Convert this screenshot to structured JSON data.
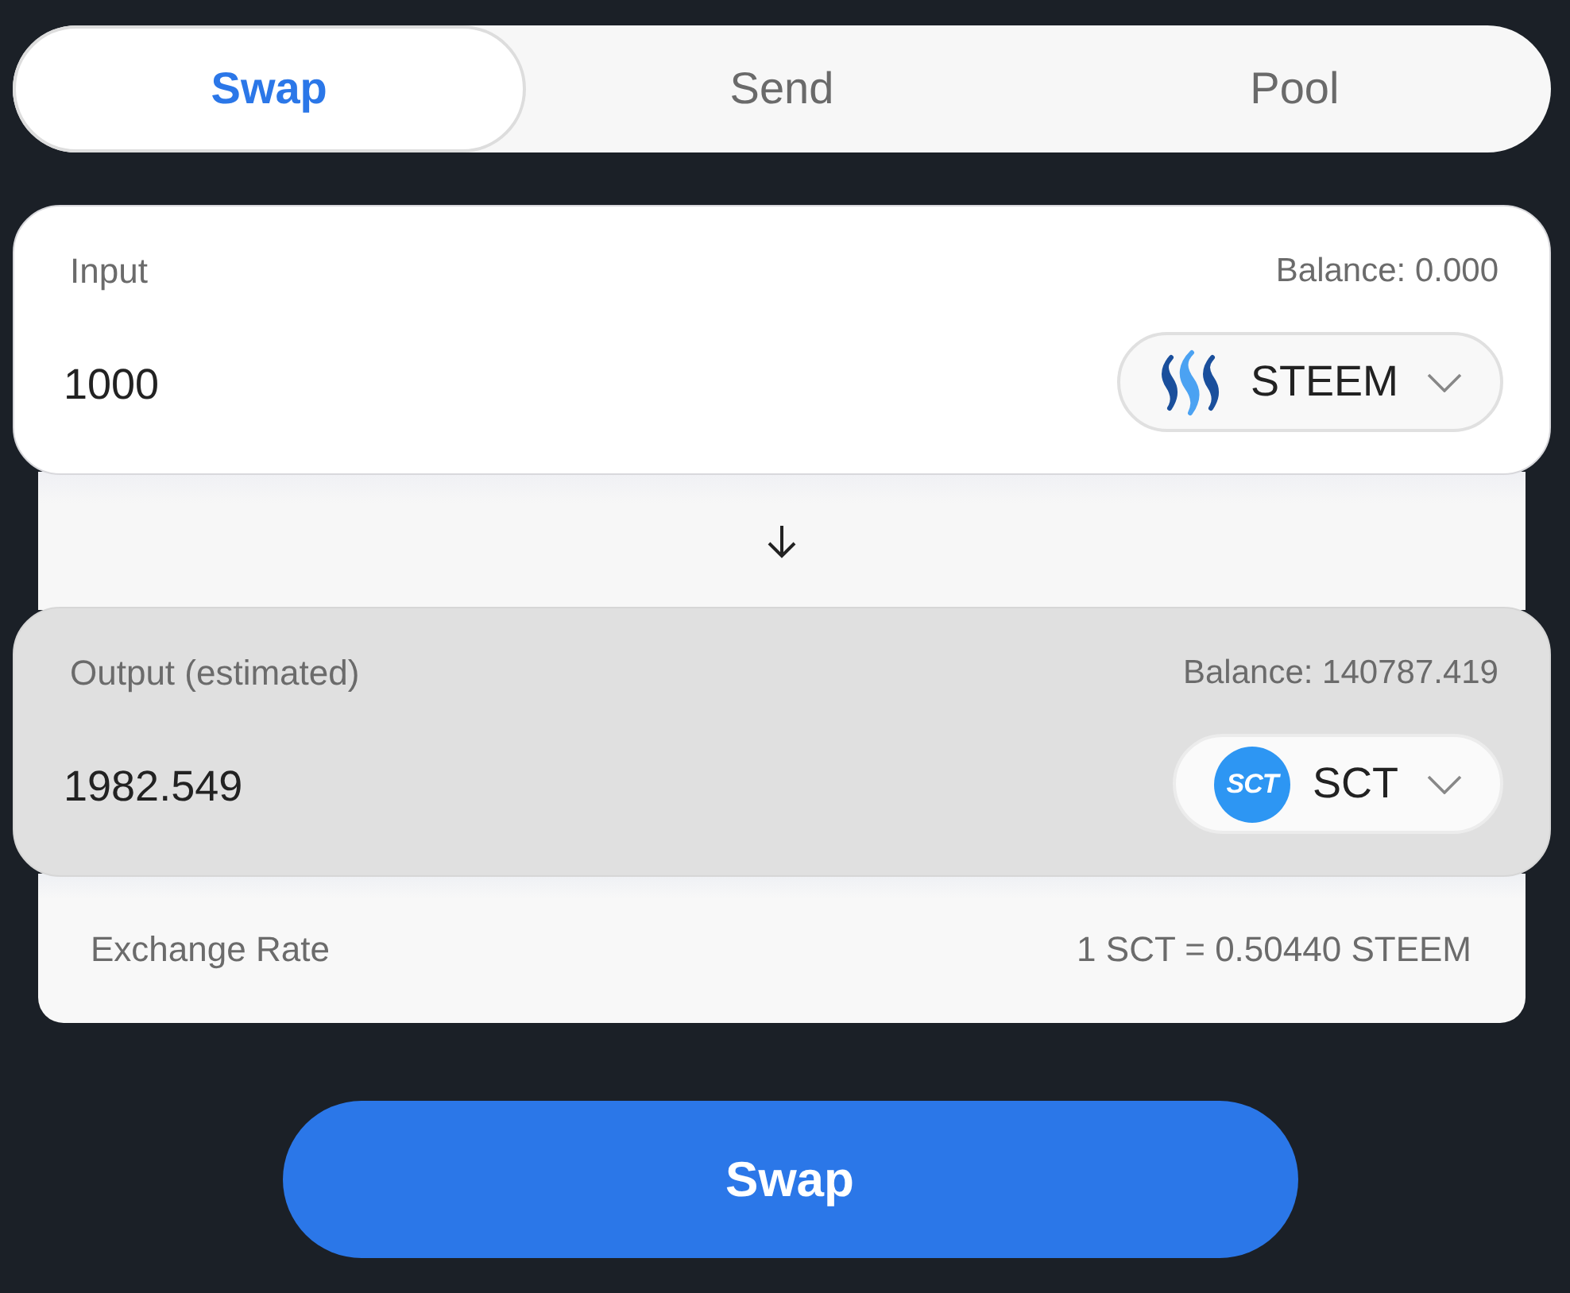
{
  "tabs": [
    {
      "label": "Swap",
      "selected": true
    },
    {
      "label": "Send",
      "selected": false
    },
    {
      "label": "Pool",
      "selected": false
    }
  ],
  "panels": [
    {
      "kind": "editable",
      "label": "Input",
      "balance": "Balance: 0.000",
      "value": "1000",
      "token": {
        "kind": "steem",
        "symbol": "STEEM"
      }
    },
    {
      "kind": "estimated",
      "label": "Output (estimated)",
      "balance": "Balance: 140787.419",
      "value": "1982.549",
      "token": {
        "kind": "sct",
        "symbol": "SCT",
        "logo_text": "SCT"
      }
    }
  ],
  "exchange_rate": {
    "label": "Exchange Rate",
    "value": "1 SCT = 0.50440 STEEM"
  },
  "action_button": {
    "label": "Swap"
  }
}
